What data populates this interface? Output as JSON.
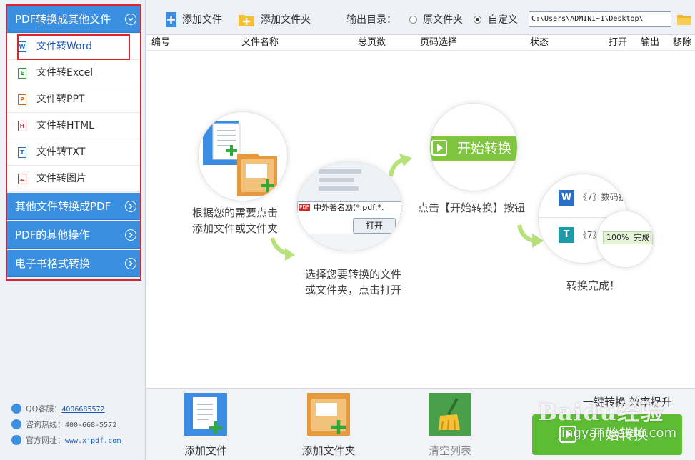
{
  "sidebar": {
    "category_main": "PDF转换成其他文件",
    "items": [
      {
        "label": "文件转Word",
        "icon": "word-file-icon",
        "letter": "W"
      },
      {
        "label": "文件转Excel",
        "icon": "excel-file-icon",
        "letter": "E"
      },
      {
        "label": "文件转PPT",
        "icon": "ppt-file-icon",
        "letter": "P"
      },
      {
        "label": "文件转HTML",
        "icon": "html-file-icon",
        "letter": "H"
      },
      {
        "label": "文件转TXT",
        "icon": "txt-file-icon",
        "letter": "T"
      },
      {
        "label": "文件转图片",
        "icon": "image-file-icon",
        "letter": ""
      }
    ],
    "categories": [
      "其他文件转换成PDF",
      "PDF的其他操作",
      "电子书格式转换"
    ],
    "contact": {
      "qq_label": "QQ客服：",
      "qq_value": "4006685572",
      "hotline_label": "咨询热线：",
      "hotline_value": "400-668-5572",
      "site_label": "官方网址：",
      "site_value": "www.xjpdf.com"
    }
  },
  "toolbar": {
    "add_file": "添加文件",
    "add_folder": "添加文件夹",
    "output_label": "输出目录：",
    "option_original": "原文件夹",
    "option_custom": "自定义",
    "selected_option": "自定义",
    "output_path": "C:\\Users\\ADMINI~1\\Desktop\\"
  },
  "table": {
    "columns": [
      "编号",
      "文件名称",
      "总页数",
      "页码选择",
      "状态",
      "打开",
      "输出",
      "移除"
    ]
  },
  "guide": {
    "step1_line1": "根据您的需要点击",
    "step1_line2": "添加文件或文件夹",
    "step2_line1": "选择您要转换的文件",
    "step2_line2": "或文件夹，点击打开",
    "step2_dialog_text": "中外著名励",
    "step2_dialog_filter": "(*.pdf,*.",
    "step2_open_button": "打开",
    "step3_text": "点击【开始转换】按钮",
    "step3_button": "开始转换",
    "step4_item1": "《7》数码技",
    "step4_item2": "《7》",
    "step4_progress": "100%",
    "step4_status": "完成",
    "step4_text": "转换完成！"
  },
  "bottom": {
    "add_file": "添加文件",
    "add_folder": "添加文件夹",
    "clear_list": "清空列表",
    "slogan": "一键转换  效率提升",
    "start": "开始转换"
  },
  "watermark": {
    "brand": "Baidu经验",
    "url": "jingyan.baidu.com"
  },
  "colors": {
    "sidebar_blue": "#3b8fe0",
    "highlight_red": "#e0232a",
    "start_green": "#5cbc33",
    "arrow_green": "#b7e27a"
  }
}
